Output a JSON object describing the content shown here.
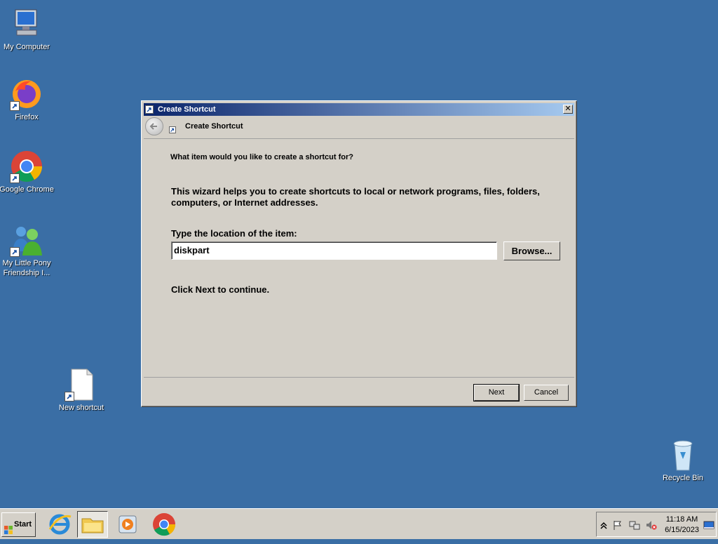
{
  "desktop": {
    "icons": [
      {
        "label": "My Computer"
      },
      {
        "label": "Firefox"
      },
      {
        "label": "Google Chrome"
      },
      {
        "label": "My Little Pony Friendship I..."
      },
      {
        "label": "New shortcut"
      },
      {
        "label": "Recycle Bin"
      }
    ]
  },
  "dialog": {
    "title": "Create Shortcut",
    "header_title": "Create Shortcut",
    "question": "What item would you like to create a shortcut for?",
    "description": "This wizard helps you to create shortcuts to local or network programs, files, folders, computers, or Internet addresses.",
    "location_label": "Type the location of the item:",
    "location_value": "diskpart",
    "browse_label": "Browse...",
    "continue_text": "Click Next to continue.",
    "next_label": "Next",
    "cancel_label": "Cancel",
    "close_glyph": "✕"
  },
  "taskbar": {
    "start_label": "Start",
    "clock_time": "11:18 AM",
    "clock_date": "6/15/2023"
  },
  "colors": {
    "desktop_bg": "#3a6ea5",
    "title_gradient_start": "#0a246a",
    "title_gradient_end": "#a6caf0",
    "face": "#d4d0c8"
  }
}
